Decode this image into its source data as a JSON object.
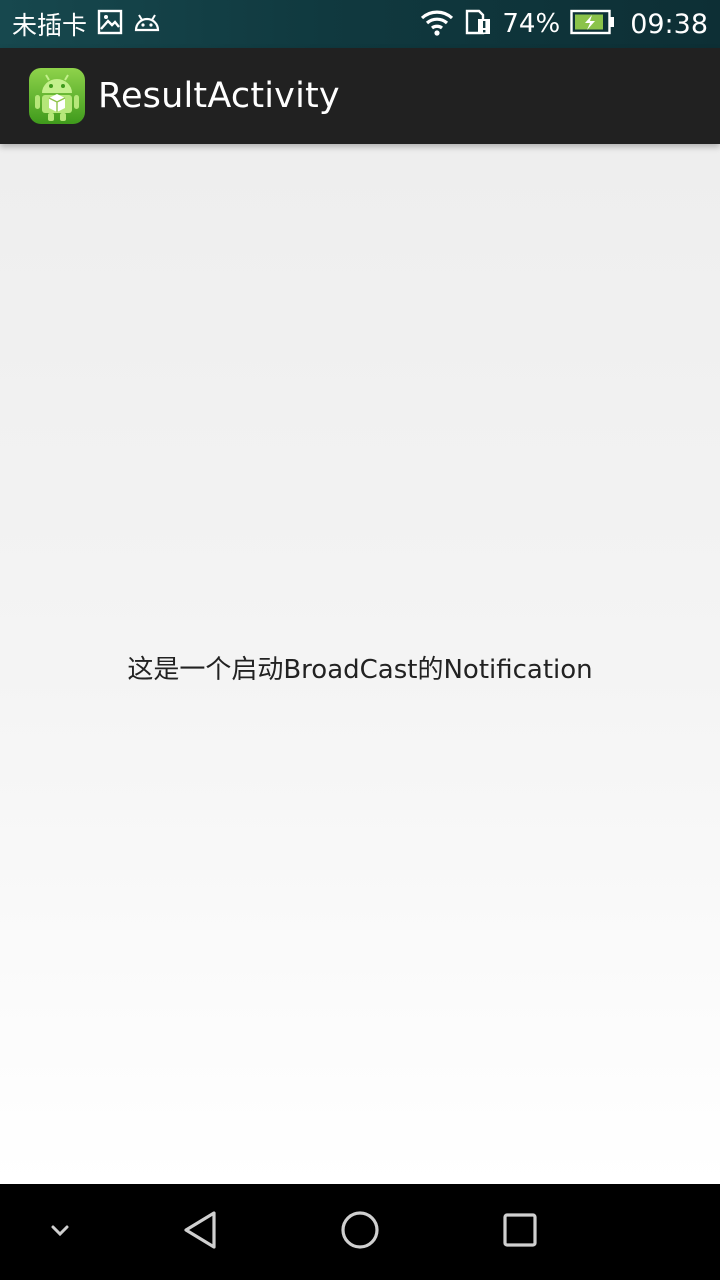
{
  "status_bar": {
    "carrier": "未插卡",
    "icons_left": [
      "image-icon",
      "android-icon"
    ],
    "icons_right": [
      "wifi-icon",
      "sim-alert-icon",
      "battery-charging-icon"
    ],
    "battery_percent": "74%",
    "time": "09:38"
  },
  "action_bar": {
    "icon": "android-app-icon",
    "title": "ResultActivity"
  },
  "content": {
    "message": "这是一个启动BroadCast的Notification"
  },
  "nav_bar": {
    "buttons": [
      "collapse-icon",
      "back-icon",
      "home-icon",
      "recents-icon"
    ]
  },
  "colors": {
    "status_bar": "#10393f",
    "action_bar": "#212121",
    "battery_fill": "#8bc34a"
  }
}
